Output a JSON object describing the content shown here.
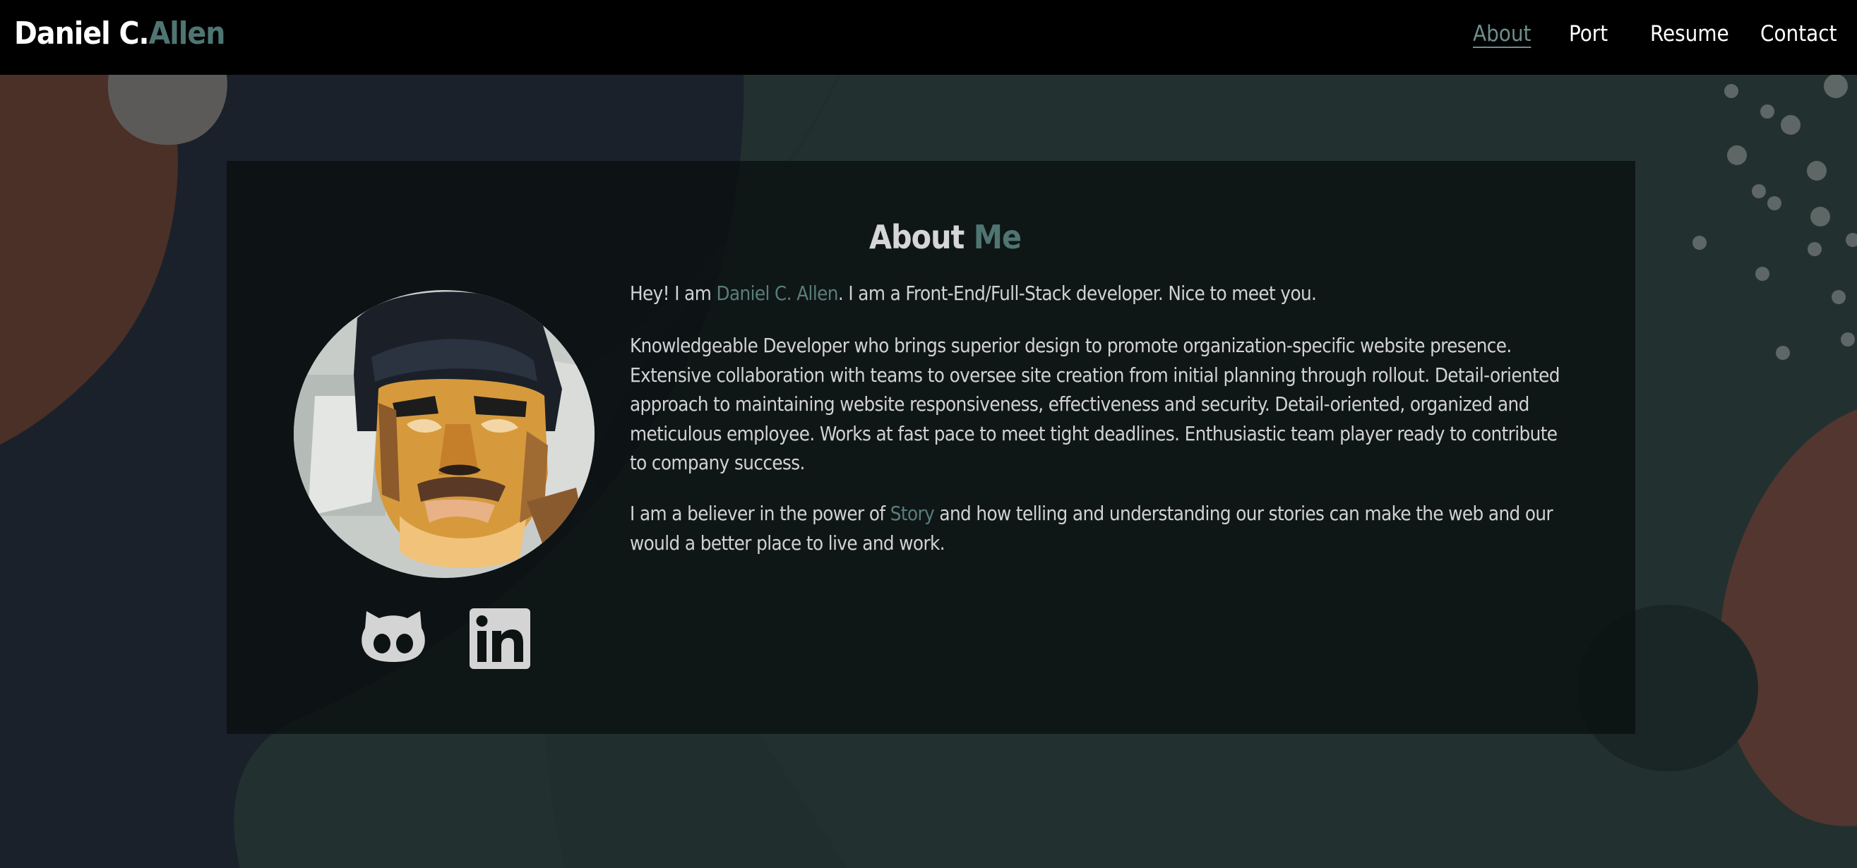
{
  "header": {
    "brand_first": "Daniel C.",
    "brand_accent": "Allen",
    "nav": [
      {
        "label": "About",
        "active": true
      },
      {
        "label": "Port",
        "active": false
      },
      {
        "label": "Resume",
        "active": false
      },
      {
        "label": "Contact",
        "active": false
      }
    ]
  },
  "about": {
    "title_main": "About",
    "title_accent": "Me",
    "intro": {
      "before": "Hey! I am ",
      "name": "Daniel C. Allen",
      "after": ". I am a Front-End/Full-Stack developer. Nice to meet you."
    },
    "summary": "Knowledgeable Developer who brings superior design to promote organization-specific website presence. Extensive collaboration with teams to oversee site creation from initial planning through rollout. Detail-oriented approach to maintaining website responsiveness, effectiveness and security. Detail-oriented, organized and meticulous employee. Works at fast pace to meet tight deadlines. Enthusiastic team player ready to contribute to company success.",
    "story": {
      "before": "I am a believer in the power of ",
      "word": "Story",
      "after": " and how telling and understanding our stories can make the web and our would a better place to live and work."
    }
  },
  "social": {
    "github_icon": "github-icon",
    "linkedin_icon": "linkedin-icon"
  },
  "colors": {
    "accent": "#4f7572",
    "nav_active": "#6d8e8c",
    "navbar_bg": "#000000",
    "card_bg": "#0c1313",
    "text": "#d2d2d2",
    "blob_brown": "#5a3a31",
    "bg_teal": "#223231"
  }
}
